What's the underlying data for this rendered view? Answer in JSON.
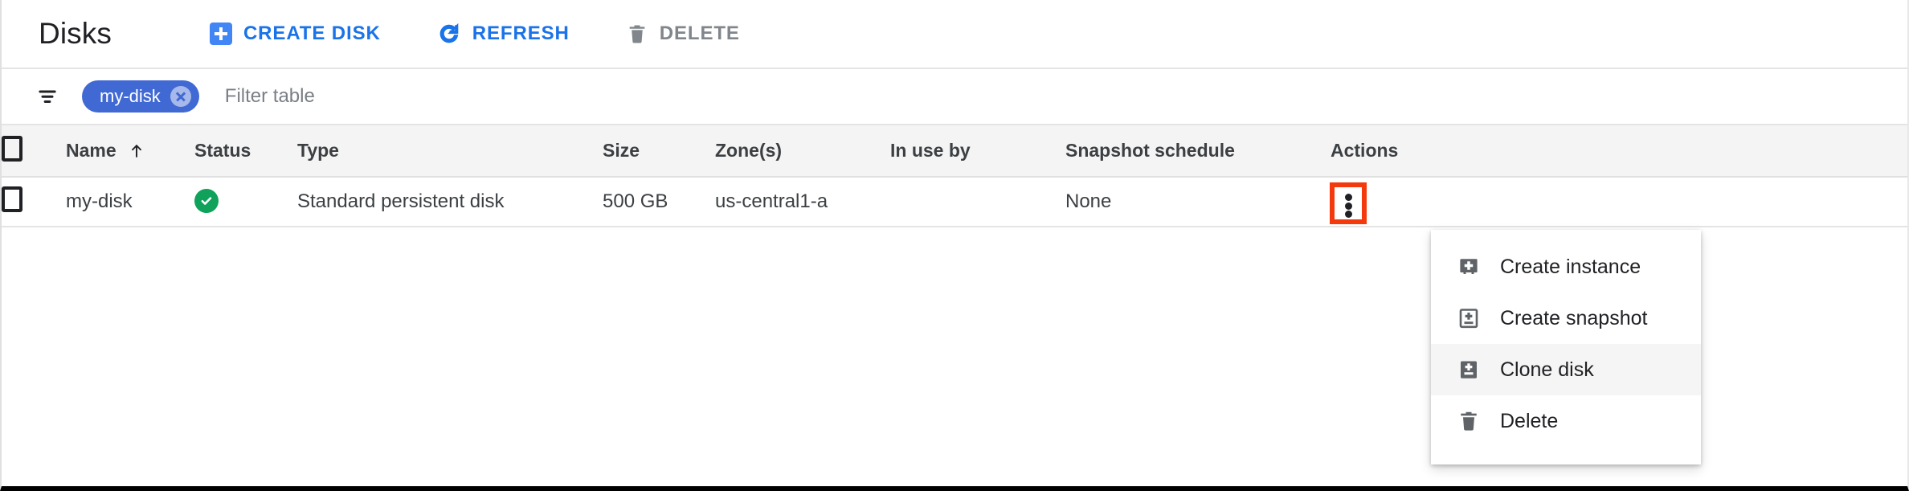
{
  "header": {
    "title": "Disks",
    "buttons": [
      {
        "label": "CREATE DISK",
        "icon": "create-disk-icon",
        "color": "#1a73e8"
      },
      {
        "label": "REFRESH",
        "icon": "refresh-icon",
        "color": "#1a73e8"
      },
      {
        "label": "DELETE",
        "icon": "trash-icon",
        "color": "#80868b"
      }
    ]
  },
  "filter": {
    "icon": "filter-list-icon",
    "chip": {
      "label": "my-disk",
      "remove_icon": "chip-remove-icon",
      "color": "#4169d4"
    },
    "placeholder": "Filter table",
    "value": ""
  },
  "table": {
    "columns": [
      {
        "key": "checkbox",
        "label": ""
      },
      {
        "key": "name",
        "label": "Name",
        "sorted": true,
        "sort_icon": "arrow-up-icon"
      },
      {
        "key": "status",
        "label": "Status"
      },
      {
        "key": "type",
        "label": "Type"
      },
      {
        "key": "size",
        "label": "Size"
      },
      {
        "key": "zone",
        "label": "Zone(s)"
      },
      {
        "key": "inuseby",
        "label": "In use by"
      },
      {
        "key": "snapshot",
        "label": "Snapshot schedule"
      },
      {
        "key": "actions",
        "label": "Actions"
      }
    ],
    "rows": [
      {
        "name": "my-disk",
        "status_icon": "check-circle-icon",
        "status_color": "#10a15a",
        "type": "Standard persistent disk",
        "size": "500 GB",
        "zone": "us-central1-a",
        "inuseby": "",
        "snapshot": "None",
        "actions_icon": "more-vert-icon"
      }
    ]
  },
  "highlight": {
    "color": "#f43a0c"
  },
  "menu": {
    "items": [
      {
        "label": "Create instance",
        "icon": "create-instance-icon",
        "hovered": false
      },
      {
        "label": "Create snapshot",
        "icon": "create-snapshot-icon",
        "hovered": false
      },
      {
        "label": "Clone disk",
        "icon": "clone-disk-icon",
        "hovered": true
      },
      {
        "label": "Delete",
        "icon": "trash-icon",
        "hovered": false
      }
    ]
  }
}
